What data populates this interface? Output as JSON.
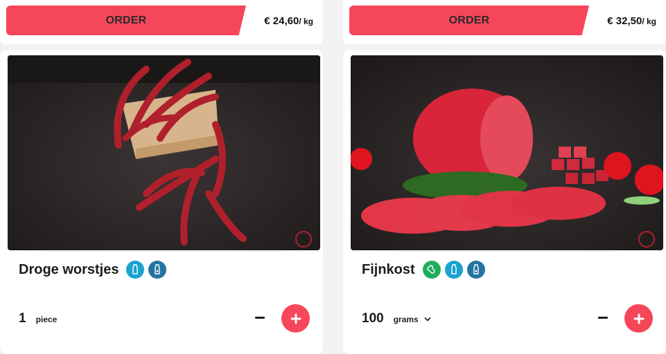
{
  "products": [
    {
      "order_label": "ORDER",
      "price": "€ 24,60",
      "price_unit": "/ kg",
      "name": "Droge worstjes",
      "icons": [
        "bottle-icon",
        "bottle-icon"
      ],
      "quantity": "1",
      "quantity_unit": "piece",
      "has_unit_dropdown": false
    },
    {
      "order_label": "ORDER",
      "price": "€ 32,50",
      "price_unit": "/ kg",
      "name": "Fijnkost",
      "icons": [
        "peanut-icon",
        "bottle-icon",
        "bottle-icon"
      ],
      "quantity": "100",
      "quantity_unit": "grams",
      "has_unit_dropdown": true
    }
  ],
  "colors": {
    "accent": "#f6465a",
    "badge_light_blue": "#1aa3cf",
    "badge_dark_blue": "#2374a3",
    "badge_green": "#1fae5a"
  }
}
